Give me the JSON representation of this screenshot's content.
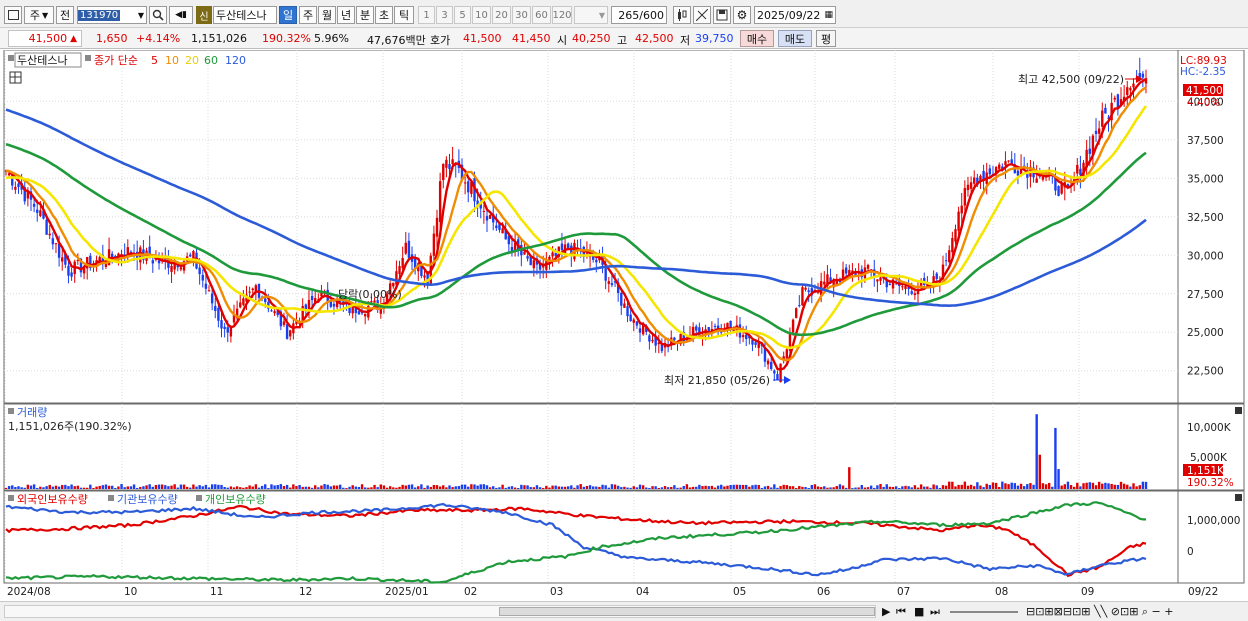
{
  "toolbar": {
    "market_label": "주",
    "prev_label": "전",
    "stock_code": "131970",
    "stock_name": "두산테스나",
    "badge_new": "신",
    "period_tabs": [
      "일",
      "주",
      "월",
      "년",
      "분",
      "초",
      "틱"
    ],
    "interval_buttons": [
      "1",
      "3",
      "5",
      "10",
      "20",
      "30",
      "60",
      "120"
    ],
    "count_display": "265/600",
    "date_value": "2025/09/22"
  },
  "quote": {
    "price": "41,500",
    "change": "1,650",
    "change_pct": "+4.14%",
    "volume": "1,151,026",
    "vol_ratio": "190.32%",
    "turnover": "5.96%",
    "amount": "47,676백만",
    "ask_label": "호가",
    "ask1": "41,500",
    "ask2": "41,450",
    "open_label": "시",
    "open": "40,250",
    "high_label": "고",
    "high": "42,500",
    "low_label": "저",
    "low": "39,750",
    "buy_label": "매수",
    "sell_label": "매도",
    "avg_label": "평"
  },
  "price_panel": {
    "legend_name": "두산테스나",
    "legend_ma_label": "종가 단순",
    "ma_periods": [
      "5",
      "10",
      "20",
      "60",
      "120"
    ],
    "lc_label": "LC:89.93",
    "hc_label": "HC:-2.35",
    "price_tag": "41,500",
    "pct_tag": "4.40%",
    "high_annotation": "최고 42,500 (09/22)",
    "low_annotation": "최저 21,850 (05/26)",
    "offset_label": "당락(0.00%)",
    "y_ticks": [
      "40,000",
      "37,500",
      "35,000",
      "32,500",
      "30,000",
      "27,500",
      "25,000",
      "22,500"
    ]
  },
  "volume_panel": {
    "title": "거래량",
    "value_label": "1,151,026주(190.32%)",
    "y_ticks": [
      "10,000K",
      "5,000K"
    ],
    "last_tag": "1,151K",
    "pct_tag": "190.32%"
  },
  "holding_panel": {
    "legend": [
      "외국인보유수량",
      "기관보유수량",
      "개인보유수량"
    ],
    "y_ticks": [
      "1,000,000",
      "0"
    ]
  },
  "x_axis": {
    "labels": [
      "2024/08",
      "10",
      "11",
      "12",
      "2025/01",
      "02",
      "03",
      "04",
      "05",
      "06",
      "07",
      "08",
      "09"
    ],
    "end_date": "09/22"
  },
  "colors": {
    "ma5": "#e00000",
    "ma10": "#f08c00",
    "ma20": "#f2e000",
    "ma60": "#1f9a3a",
    "ma120": "#2c5bd8",
    "up": "#e00000",
    "down": "#1a3ff0",
    "price_tag_bg": "#e00000"
  },
  "chart_data": {
    "type": "candlestick",
    "price_range": [
      20600,
      43200
    ],
    "price_ticks": [
      22500,
      25000,
      27500,
      30000,
      32500,
      35000,
      37500,
      40000
    ],
    "close_anchors": [
      [
        0,
        35500
      ],
      [
        10,
        33000
      ],
      [
        20,
        29000
      ],
      [
        30,
        29700
      ],
      [
        40,
        30300
      ],
      [
        50,
        29500
      ],
      [
        60,
        29800
      ],
      [
        70,
        25000
      ],
      [
        80,
        28000
      ],
      [
        90,
        25000
      ],
      [
        100,
        27500
      ],
      [
        110,
        26500
      ],
      [
        120,
        26800
      ],
      [
        128,
        30500
      ],
      [
        135,
        28500
      ],
      [
        140,
        36000
      ],
      [
        145,
        35500
      ],
      [
        150,
        34000
      ],
      [
        160,
        31000
      ],
      [
        170,
        29000
      ],
      [
        180,
        30500
      ],
      [
        190,
        29500
      ],
      [
        200,
        26000
      ],
      [
        210,
        24000
      ],
      [
        220,
        25000
      ],
      [
        230,
        25500
      ],
      [
        240,
        24500
      ],
      [
        247,
        22100
      ],
      [
        255,
        27500
      ],
      [
        265,
        28500
      ],
      [
        275,
        29000
      ],
      [
        285,
        28000
      ],
      [
        295,
        27800
      ],
      [
        300,
        29000
      ],
      [
        305,
        33000
      ],
      [
        310,
        35000
      ],
      [
        320,
        36000
      ],
      [
        330,
        35500
      ],
      [
        340,
        34000
      ],
      [
        350,
        38500
      ],
      [
        357,
        40500
      ],
      [
        360,
        41500
      ]
    ],
    "ma_start": {
      "ma20": 34500,
      "ma60": 39000,
      "ma120": 43500
    },
    "high_marker": {
      "value": 42500,
      "date": "09/22"
    },
    "low_marker": {
      "value": 21850,
      "date": "05/26"
    },
    "last": {
      "close": 41500,
      "volume_k": 1151
    },
    "volume_spikes": [
      [
        330,
        12000
      ],
      [
        331,
        5500
      ],
      [
        336,
        9800
      ],
      [
        337,
        3200
      ],
      [
        270,
        3500
      ]
    ],
    "volume_max_k": 13000,
    "holdings": {
      "foreign": [
        [
          0,
          650000
        ],
        [
          20,
          700000
        ],
        [
          40,
          800000
        ],
        [
          60,
          1050000
        ],
        [
          75,
          1300000
        ],
        [
          90,
          1100000
        ],
        [
          110,
          1050000
        ],
        [
          130,
          1200000
        ],
        [
          150,
          1200000
        ],
        [
          165,
          1250000
        ],
        [
          185,
          1050000
        ],
        [
          200,
          950000
        ],
        [
          220,
          850000
        ],
        [
          250,
          900000
        ],
        [
          275,
          850000
        ],
        [
          300,
          650000
        ],
        [
          310,
          800000
        ],
        [
          320,
          700000
        ],
        [
          330,
          200000
        ],
        [
          340,
          -550000
        ],
        [
          350,
          -350000
        ],
        [
          360,
          200000
        ],
        [
          365,
          300000
        ]
      ],
      "institution": [
        [
          0,
          1300000
        ],
        [
          20,
          1150000
        ],
        [
          40,
          1150000
        ],
        [
          60,
          1250000
        ],
        [
          80,
          1000000
        ],
        [
          100,
          1150000
        ],
        [
          120,
          1200000
        ],
        [
          140,
          1350000
        ],
        [
          160,
          1150000
        ],
        [
          175,
          800000
        ],
        [
          185,
          200000
        ],
        [
          200,
          -100000
        ],
        [
          220,
          -200000
        ],
        [
          240,
          -350000
        ],
        [
          260,
          -550000
        ],
        [
          270,
          -400000
        ],
        [
          280,
          -150000
        ],
        [
          300,
          -100000
        ],
        [
          315,
          -400000
        ],
        [
          330,
          -300000
        ],
        [
          340,
          -550000
        ],
        [
          350,
          -300000
        ],
        [
          365,
          -100000
        ]
      ],
      "individual": [
        [
          0,
          -650000
        ],
        [
          30,
          -600000
        ],
        [
          60,
          -650000
        ],
        [
          90,
          -700000
        ],
        [
          110,
          -650000
        ],
        [
          140,
          -750000
        ],
        [
          160,
          -200000
        ],
        [
          180,
          -50000
        ],
        [
          190,
          200000
        ],
        [
          210,
          450000
        ],
        [
          240,
          600000
        ],
        [
          260,
          750000
        ],
        [
          280,
          900000
        ],
        [
          300,
          800000
        ],
        [
          315,
          850000
        ],
        [
          330,
          1150000
        ],
        [
          340,
          1350000
        ],
        [
          350,
          1400000
        ],
        [
          360,
          1100000
        ],
        [
          365,
          950000
        ]
      ],
      "range": [
        -750000,
        1700000
      ]
    }
  }
}
